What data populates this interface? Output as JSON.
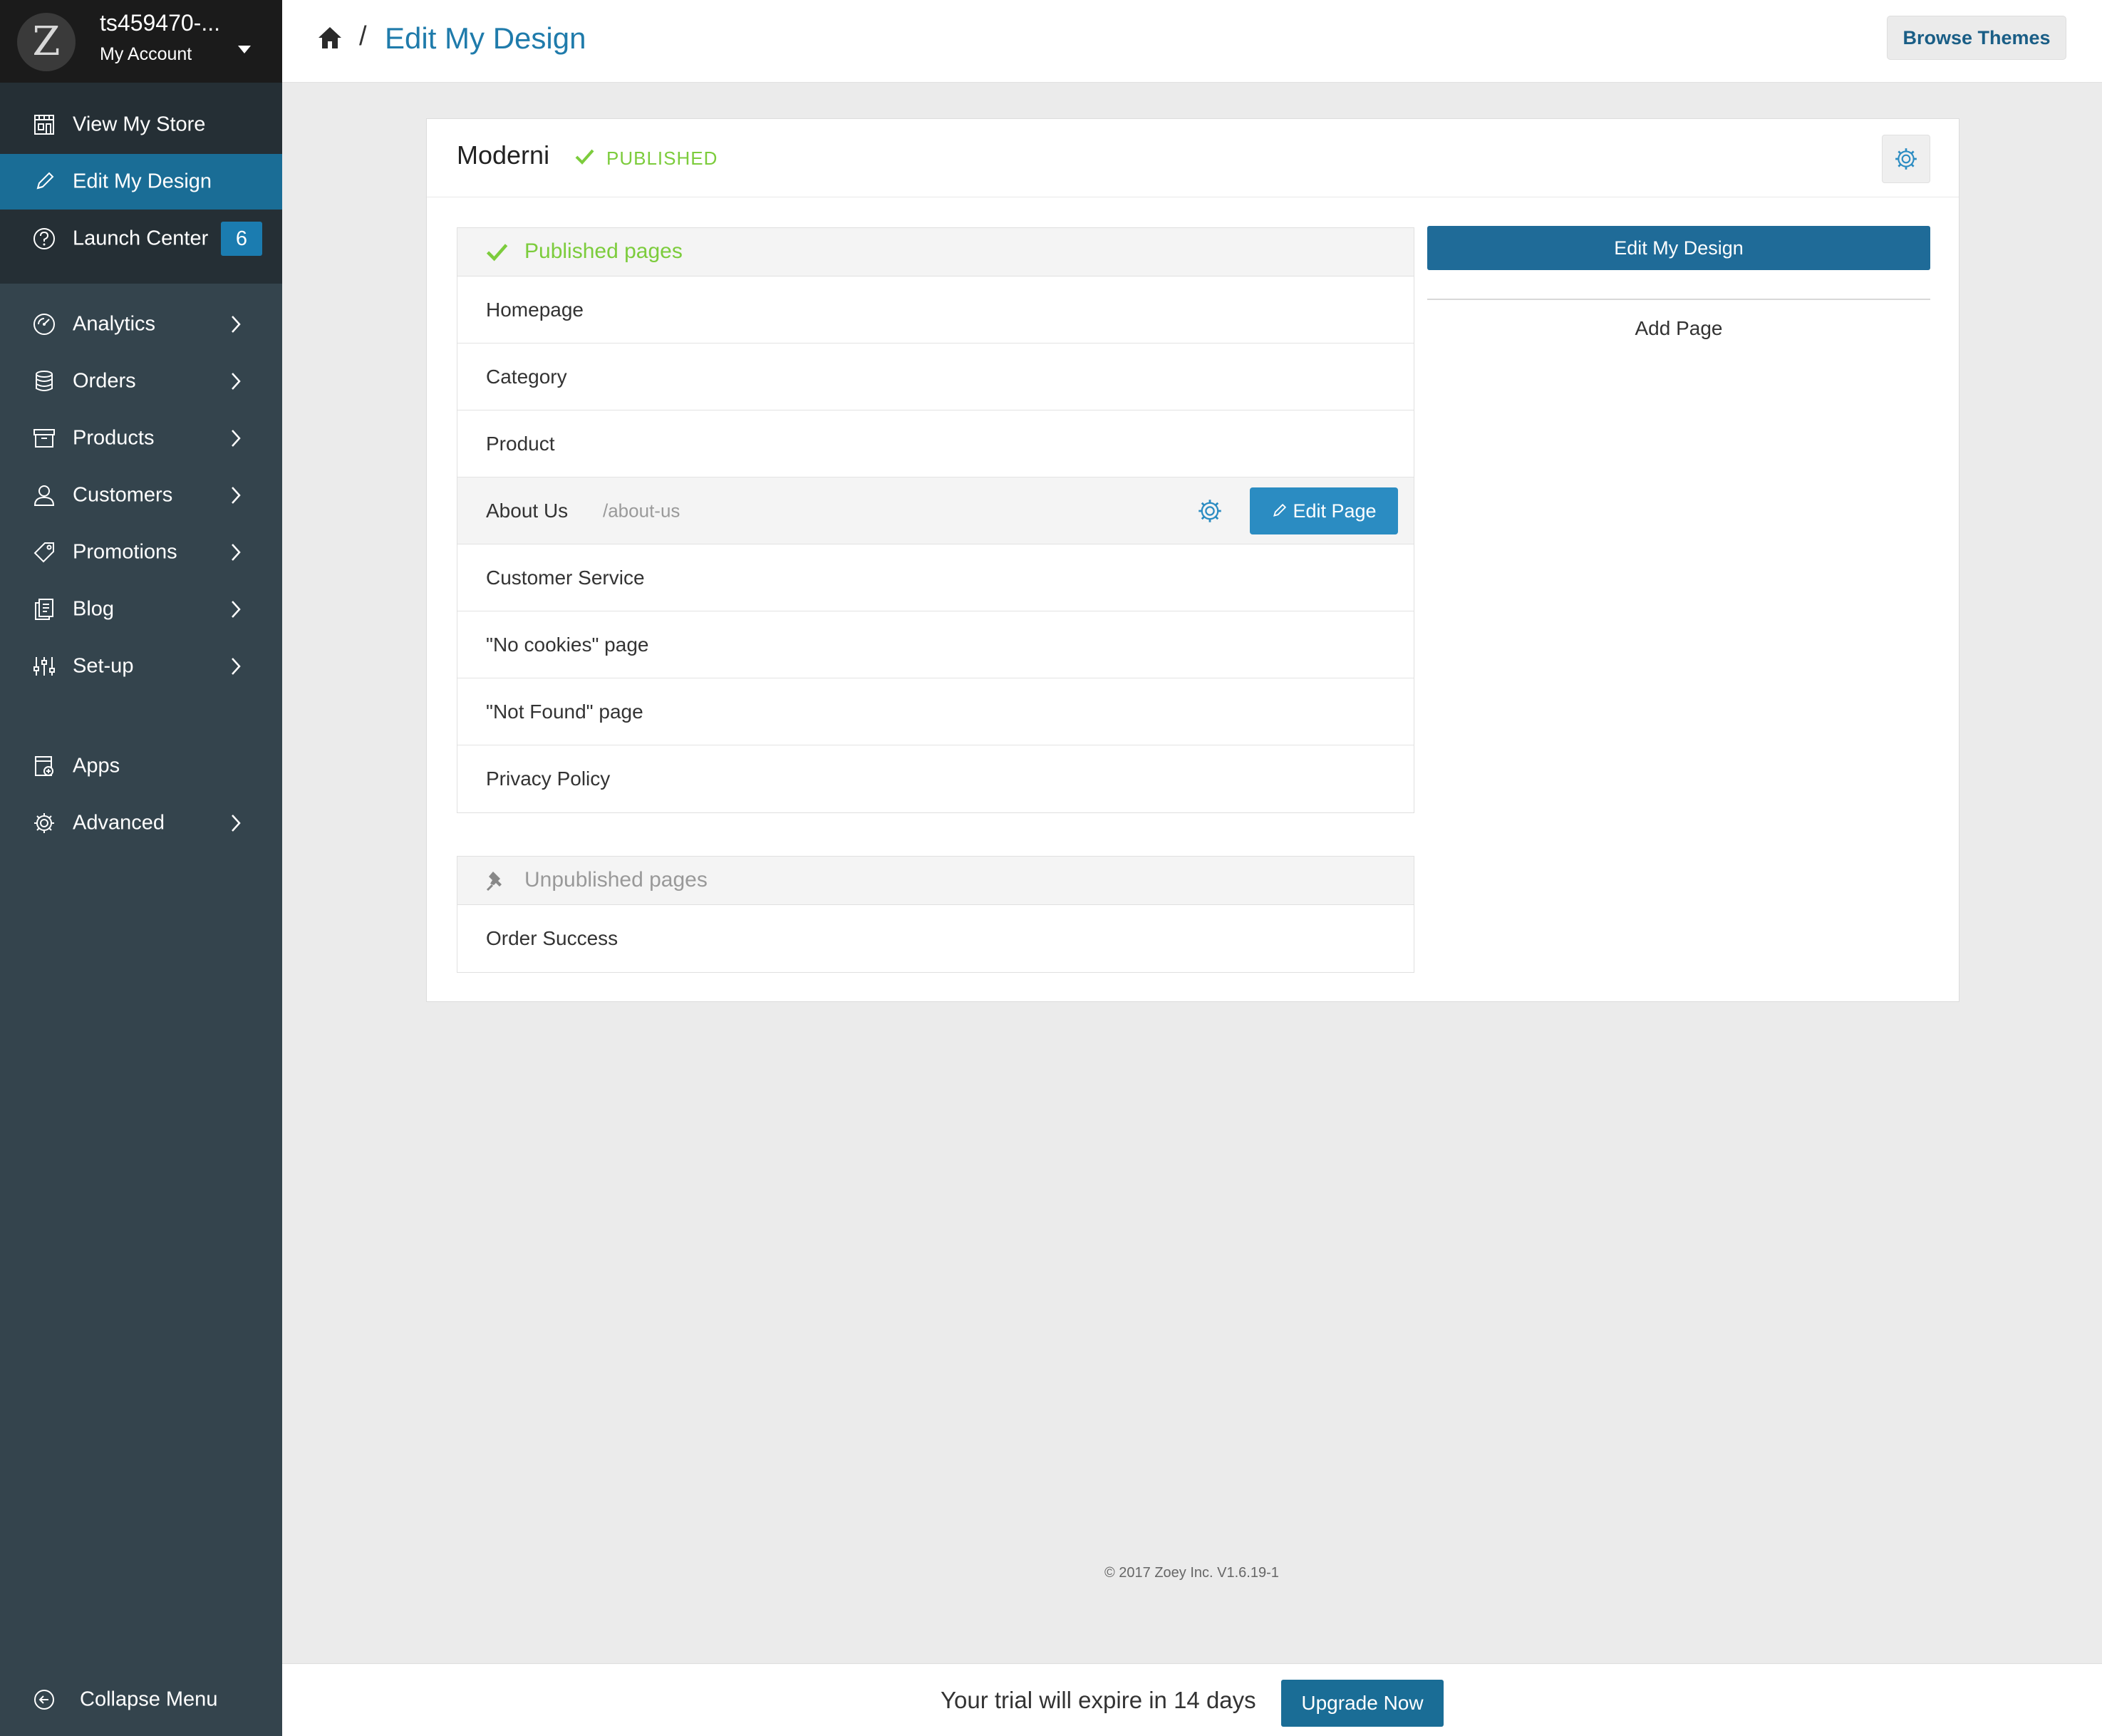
{
  "account": {
    "logo_letter": "Z",
    "name": "ts459470-...",
    "sub": "My Account"
  },
  "nav_top": [
    {
      "label": "View My Store",
      "icon": "store-icon"
    },
    {
      "label": "Edit My Design",
      "icon": "pencil-icon",
      "active": true
    },
    {
      "label": "Launch Center",
      "icon": "question-icon",
      "badge": "6"
    }
  ],
  "nav_main": [
    {
      "label": "Analytics",
      "icon": "analytics-icon"
    },
    {
      "label": "Orders",
      "icon": "orders-icon"
    },
    {
      "label": "Products",
      "icon": "products-icon"
    },
    {
      "label": "Customers",
      "icon": "customers-icon"
    },
    {
      "label": "Promotions",
      "icon": "tag-icon"
    },
    {
      "label": "Blog",
      "icon": "blog-icon"
    },
    {
      "label": "Set-up",
      "icon": "sliders-icon"
    },
    {
      "label": "Apps",
      "icon": "apps-icon"
    },
    {
      "label": "Advanced",
      "icon": "gear-icon"
    }
  ],
  "collapse_label": "Collapse Menu",
  "header": {
    "separator": "/",
    "title": "Edit My Design",
    "browse_themes": "Browse Themes"
  },
  "theme": {
    "name": "Moderni",
    "status": "PUBLISHED"
  },
  "published": {
    "heading": "Published pages",
    "pages": [
      "Homepage",
      "Category",
      "Product",
      "About Us",
      "Customer Service",
      "\"No cookies\" page",
      "\"Not Found\" page",
      "Privacy Policy"
    ],
    "hover_url": "/about-us",
    "edit_page_label": "Edit Page"
  },
  "unpublished": {
    "heading": "Unpublished pages",
    "pages": [
      "Order Success"
    ]
  },
  "actions": {
    "edit_design": "Edit My Design",
    "add_page": "Add Page"
  },
  "footer": "© 2017 Zoey Inc. V1.6.19-1",
  "trial": {
    "text": "Your trial will expire in 14 days",
    "upgrade": "Upgrade Now"
  },
  "colors": {
    "sidebar": "#34444d",
    "active": "#1a6d96",
    "accent": "#1f7bab",
    "success": "#7ccc3c"
  }
}
